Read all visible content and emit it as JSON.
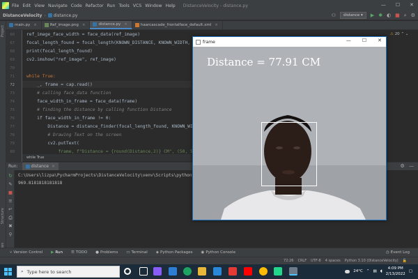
{
  "menubar": {
    "items": [
      "File",
      "Edit",
      "View",
      "Navigate",
      "Code",
      "Refactor",
      "Run",
      "Tools",
      "VCS",
      "Window",
      "Help"
    ],
    "title": "DistanceVelocity - distance.py"
  },
  "navbar": {
    "project": "DistanceVelocity",
    "file": "distance.py",
    "run_config": "distance"
  },
  "tabs": [
    {
      "label": "main.py",
      "icon": "python-file-icon"
    },
    {
      "label": "Ref_image.png",
      "icon": "image-file-icon"
    },
    {
      "label": "distance.py",
      "icon": "python-file-icon",
      "active": true
    },
    {
      "label": "haarcascade_frontalface_default.xml",
      "icon": "xml-file-icon"
    }
  ],
  "editor": {
    "line_numbers": [
      "66",
      "67",
      "68",
      "69",
      "70",
      "71",
      "72",
      "73",
      "74",
      "75",
      "76",
      "77",
      "78",
      "79",
      "80"
    ],
    "current_line": "72",
    "inspection_count": "20",
    "breadcrumb": "while True",
    "code_lines": [
      "ref_image_face_width = face_data(ref_image)",
      "focal_length_found = focal_length(KNOWN_DISTANCE, KNOWN_WIDTH, ref_",
      "print(focal_length_found)",
      "cv2.imshow(\"ref_image\", ref_image)",
      "",
      "while True:",
      "    _, frame = cap.read()",
      "    # calling face_data function",
      "    face_width_in_frame = face_data(frame)",
      "    # finding the distance by calling function Distance",
      "    if face_width_in_frame != 0:",
      "        Distance = distance_finder(focal_length_found, KNOWN_WIDTH,",
      "        # Drawing Text on the screen",
      "        cv2.putText(",
      "            frame, f\"Distance = {round(Distance,2)} CM\", (50, 50), "
    ]
  },
  "run": {
    "label": "Run:",
    "tab": "distance",
    "console": [
      "C:\\Users\\lizpa\\PycharmProjects\\DistanceVelocity\\venv\\Scripts\\python.",
      "969.8181818181818"
    ]
  },
  "bottom_tools": [
    {
      "label": "Version Control",
      "icon": "vcs-icon"
    },
    {
      "label": "Run",
      "icon": "run-icon",
      "active": true
    },
    {
      "label": "TODO",
      "icon": "todo-icon"
    },
    {
      "label": "Problems",
      "icon": "problems-icon"
    },
    {
      "label": "Terminal",
      "icon": "terminal-icon"
    },
    {
      "label": "Python Packages",
      "icon": "packages-icon"
    },
    {
      "label": "Python Console",
      "icon": "console-icon"
    }
  ],
  "event_log": "Event Log",
  "statusbar": {
    "position": "72:26",
    "line_sep": "CRLF",
    "encoding": "UTF-8",
    "indent": "4 spaces",
    "interpreter": "Python 3.10 (DistanceVelocity)"
  },
  "left_strip": {
    "project": "Project",
    "structure": "Structure",
    "favorites": "Favorites"
  },
  "frame_window": {
    "title": "frame",
    "overlay_text": "Distance = 77.91 CM"
  },
  "taskbar": {
    "search_placeholder": "Type here to search",
    "temperature": "24°C",
    "time": "4:09 PM",
    "date": "2/13/2022"
  }
}
